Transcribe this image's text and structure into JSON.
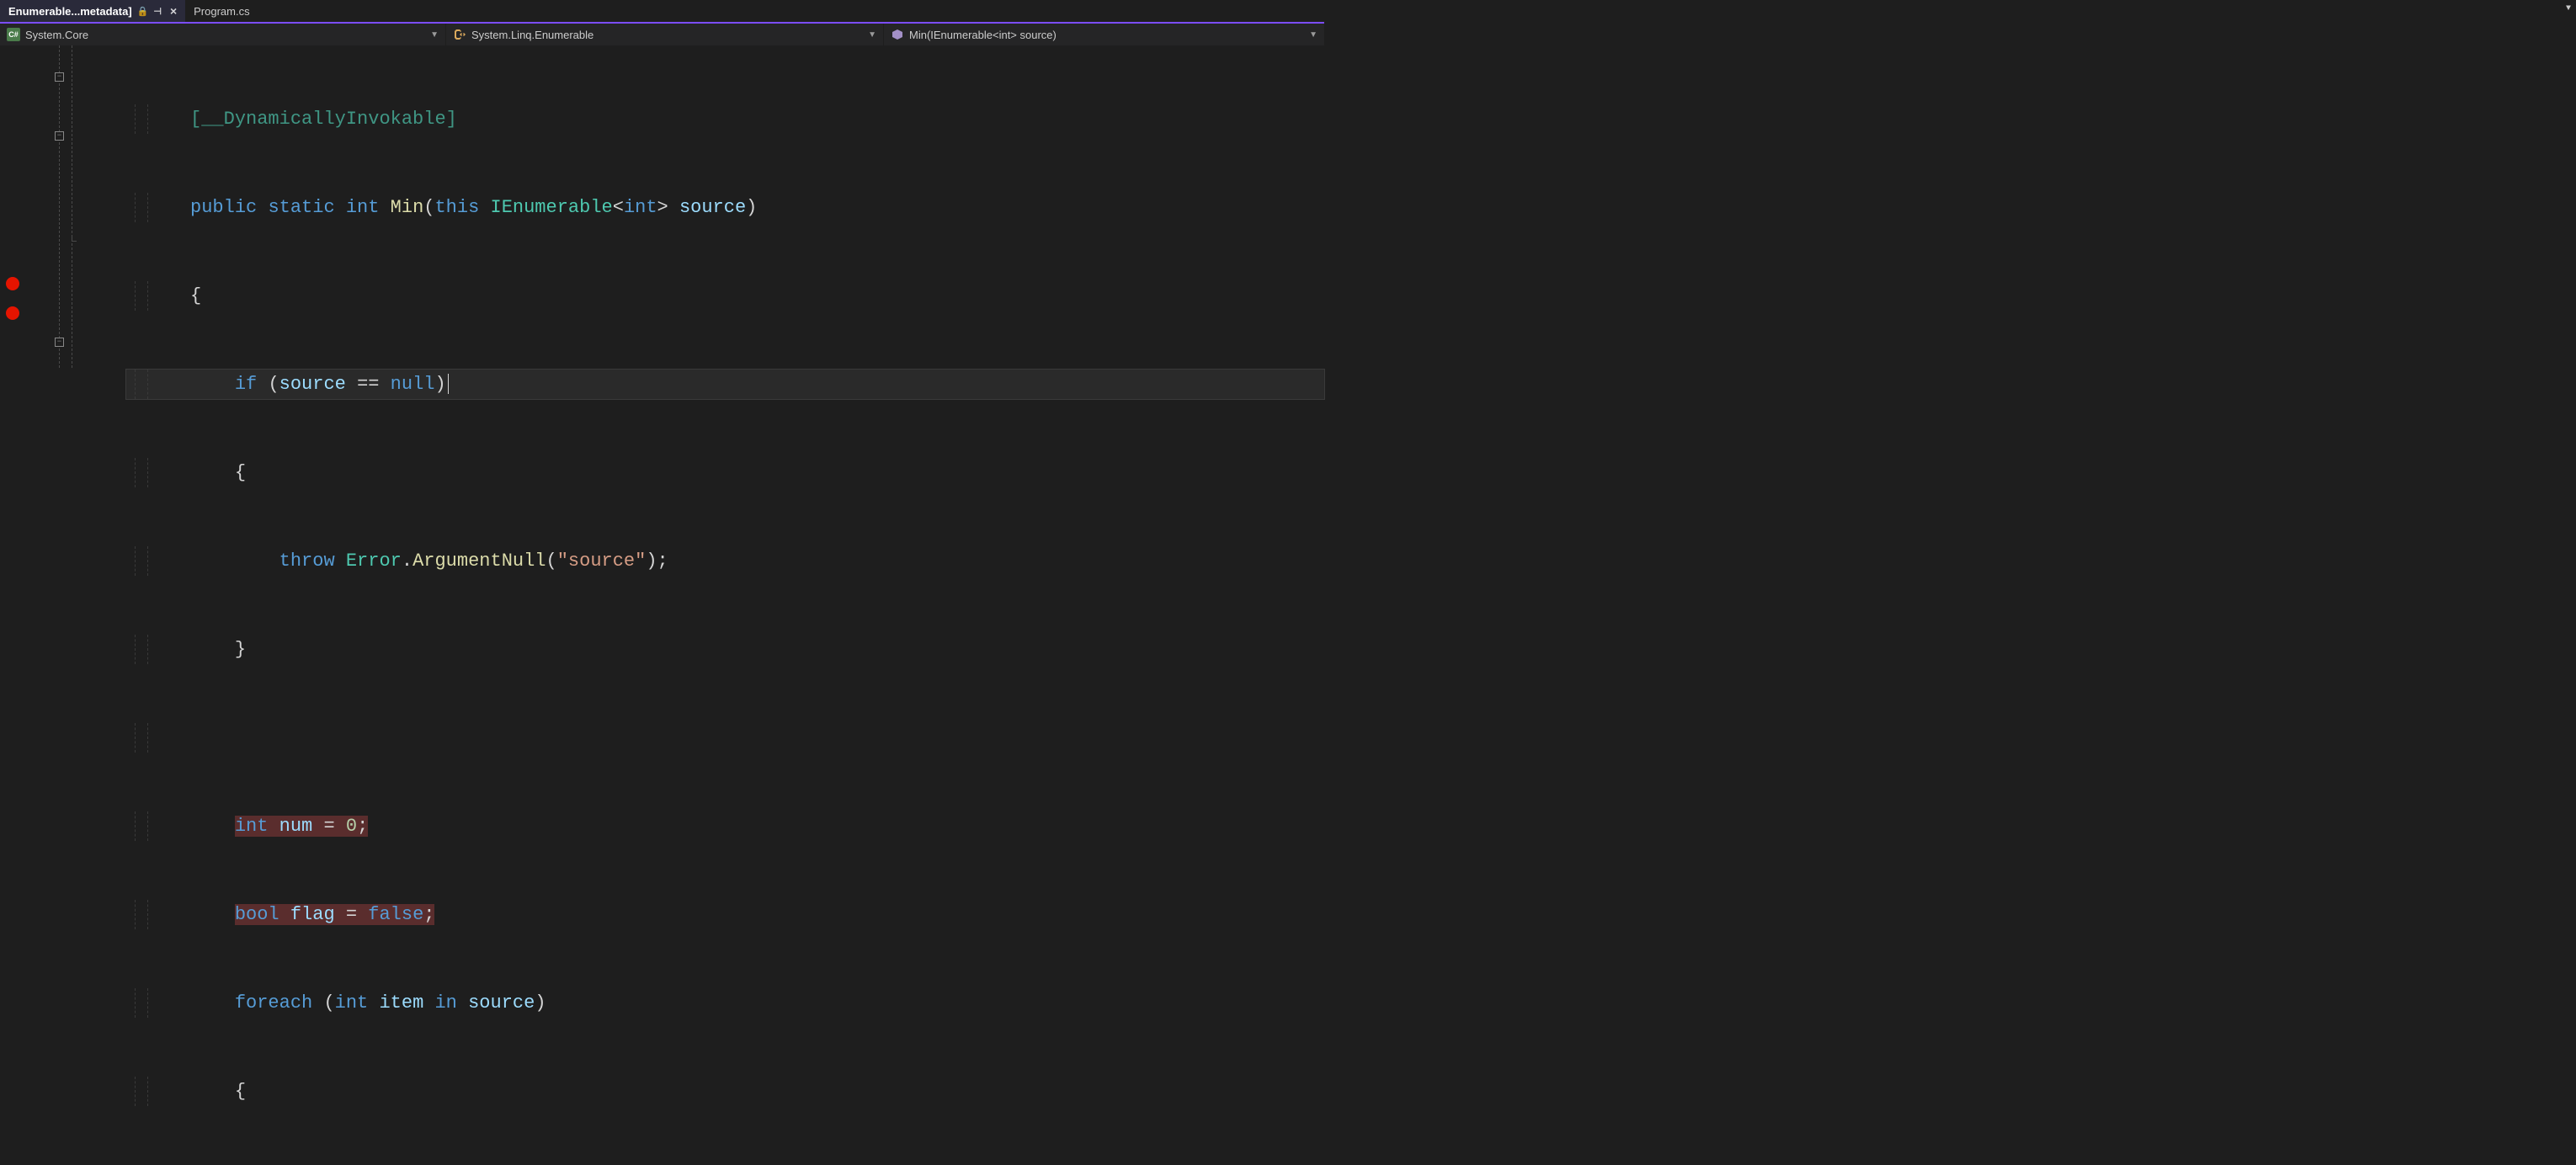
{
  "tabs": [
    {
      "label": "Enumerable...metadata]",
      "active": true,
      "locked": true,
      "pinned": true
    },
    {
      "label": "Program.cs",
      "active": false
    }
  ],
  "nav": {
    "assembly": "System.Core",
    "namespace": "System.Linq.Enumerable",
    "member": "Min(IEnumerable<int> source)"
  },
  "code": {
    "attr_partial": "[__DynamicallyInvokable]",
    "line_sig_1": "public",
    "line_sig_2": "static",
    "line_sig_3": "int",
    "line_sig_4": "Min",
    "line_sig_5": "this",
    "line_sig_6": "IEnumerable",
    "line_sig_7": "int",
    "line_sig_8": "source",
    "brace_open": "{",
    "if_kw": "if",
    "if_var": "source",
    "if_op": "==",
    "if_null": "null",
    "throw_kw": "throw",
    "throw_class": "Error",
    "throw_method": "ArgumentNull",
    "throw_str": "\"source\"",
    "brace_close": "}",
    "int_kw": "int",
    "num_var": "num",
    "eq": "=",
    "zero": "0",
    "bool_kw": "bool",
    "flag_var": "flag",
    "false_kw": "false",
    "foreach_kw": "foreach",
    "item_var": "item",
    "in_kw": "in",
    "source_var": "source"
  }
}
